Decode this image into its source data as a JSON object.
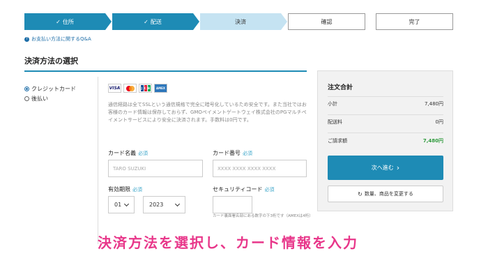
{
  "steps": [
    {
      "label": "住所",
      "state": "done"
    },
    {
      "label": "配送",
      "state": "done"
    },
    {
      "label": "決済",
      "state": "current"
    },
    {
      "label": "確認",
      "state": "todo"
    },
    {
      "label": "完了",
      "state": "todo"
    }
  ],
  "check_glyph": "✓",
  "qa_link": "お支払い方法に関するQ&A",
  "qa_icon": "?",
  "section_title": "決済方法の選択",
  "payment_methods": [
    {
      "label": "クレジットカード",
      "selected": true
    },
    {
      "label": "後払い",
      "selected": false
    }
  ],
  "card_brands": {
    "visa": "VISA",
    "jcb": [
      "J",
      "C",
      "B"
    ],
    "amex": "AMEX"
  },
  "description": "通信経路は全てSSLという通信規格で完全に暗号化しているため安全です。また当社ではお客様のカード情報は保存しておらず、GMOペイメントゲートウェイ株式会社のPGマルチペイメントサービスにより安全に決済されます。手数料は0円です。",
  "form": {
    "required_tag": "必須",
    "card_name": {
      "label": "カード名義",
      "placeholder": "TARO SUZUKI"
    },
    "card_number": {
      "label": "カード番号",
      "placeholder": "XXXX XXXX XXXX XXXX"
    },
    "expiry": {
      "label": "有効期限",
      "month": "01",
      "year": "2023"
    },
    "security_code": {
      "label": "セキュリティコード",
      "value": "",
      "note": "カード裏面署名部にある数字の下3桁です（AMEXは4桁）"
    }
  },
  "summary": {
    "title": "注文合計",
    "subtotal_label": "小計",
    "subtotal_value": "7,480円",
    "shipping_label": "配送料",
    "shipping_value": "0円",
    "total_label": "ご請求額",
    "total_value": "7,480円",
    "next_button": "次へ進む",
    "next_chevron": "›",
    "change_button": "数量、商品を変更する",
    "refresh_glyph": "↻"
  },
  "caption": "決済方法を選択し、カード情報を入力",
  "colors": {
    "primary": "#1e8bb5",
    "current_step": "#c5e3f2",
    "total_green": "#2e9a3c",
    "caption_pink": "#e8378a"
  }
}
